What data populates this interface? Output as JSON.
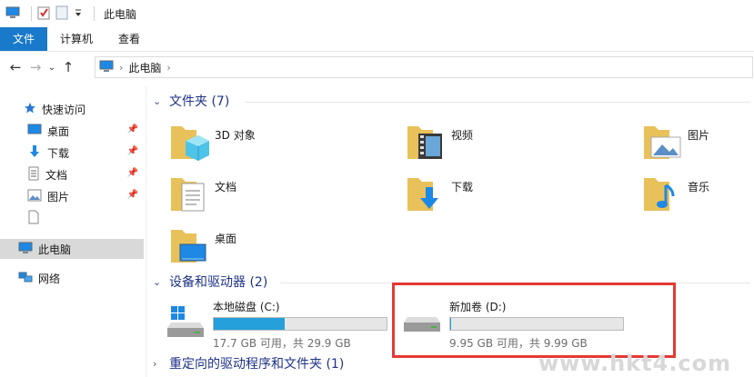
{
  "window": {
    "title": "此电脑"
  },
  "ribbon": {
    "tabs": [
      {
        "label": "文件",
        "active": true
      },
      {
        "label": "计算机",
        "active": false
      },
      {
        "label": "查看",
        "active": false
      }
    ]
  },
  "address": {
    "crumb": "此电脑"
  },
  "sidebar": {
    "quick_access": "快速访问",
    "items": [
      "桌面",
      "下载",
      "文档",
      "图片"
    ],
    "this_pc": "此电脑",
    "network": "网络"
  },
  "main": {
    "folders_header": "文件夹 (7)",
    "folders": [
      "3D 对象",
      "视频",
      "图片",
      "文档",
      "下载",
      "音乐",
      "桌面"
    ],
    "drives_header": "设备和驱动器 (2)",
    "drives": [
      {
        "name": "本地磁盘 (C:)",
        "info": "17.7 GB 可用，共 29.9 GB",
        "used_fraction": 0.41
      },
      {
        "name": "新加卷 (D:)",
        "info": "9.95 GB 可用，共 9.99 GB",
        "used_fraction": 0.004
      }
    ],
    "redirect_header": "重定向的驱动程序和文件夹 (1)"
  },
  "watermark": "www.hkt4.com",
  "colors": {
    "accent": "#1979ca",
    "group_header": "#1e3287",
    "drive_fill": "#26a0da",
    "highlight": "#e53935"
  }
}
